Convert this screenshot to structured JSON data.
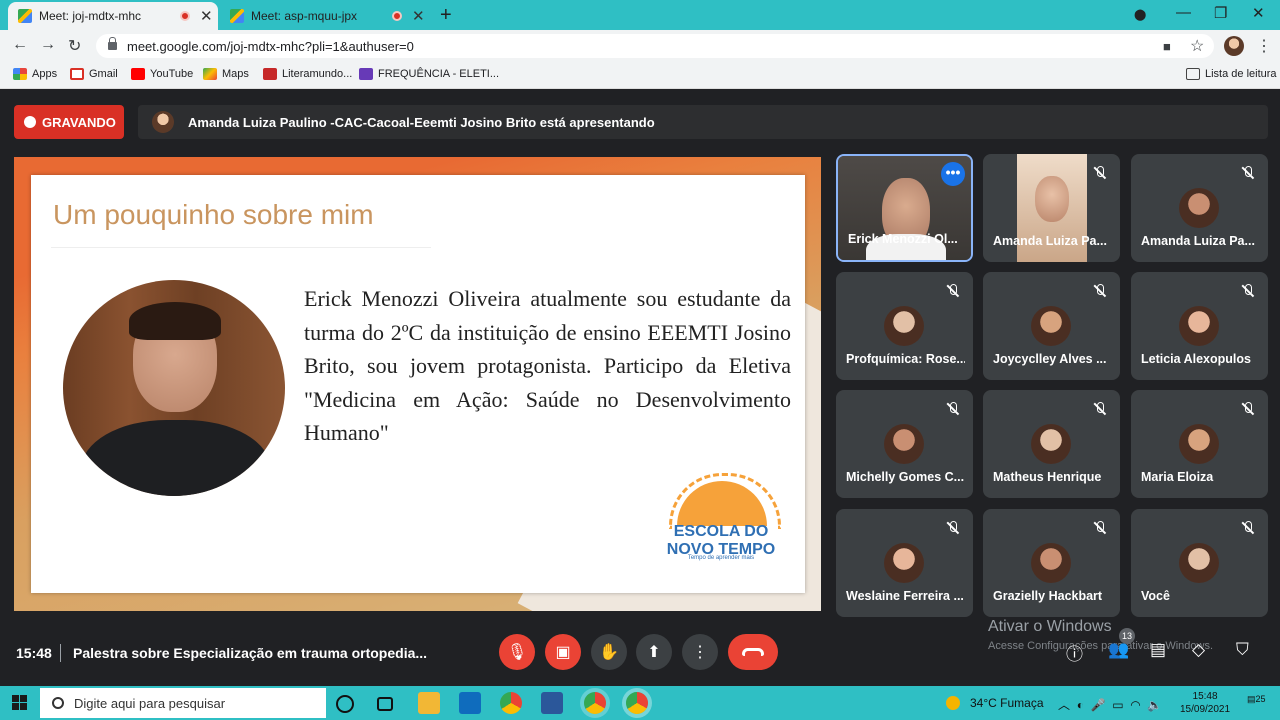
{
  "browser": {
    "tabs": [
      {
        "title": "Meet: joj-mdtx-mhc",
        "active": true
      },
      {
        "title": "Meet: asp-mquu-jpx",
        "active": false
      }
    ],
    "url": "meet.google.com/joj-mdtx-mhc?pli=1&authuser=0",
    "bookmarks": [
      {
        "label": "Apps",
        "color": "#e8453c"
      },
      {
        "label": "Gmail",
        "color": "#d93025"
      },
      {
        "label": "YouTube",
        "color": "#ff0000"
      },
      {
        "label": "Maps",
        "color": "#34a853"
      },
      {
        "label": "Literamundo...",
        "color": "#c62828"
      },
      {
        "label": "FREQUÊNCIA - ELETI...",
        "color": "#673ab7"
      }
    ],
    "reading_list": "Lista de leitura"
  },
  "meet": {
    "recording_label": "GRAVANDO",
    "presenter_banner": "Amanda Luiza Paulino -CAC-Cacoal-Eeemti Josino Brito está apresentando",
    "slide": {
      "title": "Um pouquinho sobre mim",
      "body": "Erick Menozzi Oliveira atualmente sou estudante da turma do 2ºC da instituição de ensino EEEMTI Josino Brito, sou jovem protagonista. Participo da Eletiva \"Medicina em Ação: Saúde no Desenvolvimento Humano\"",
      "logo_line1": "ESCOLA DO",
      "logo_line2": "NOVO TEMPO",
      "logo_tagline": "Tempo de aprender mais"
    },
    "participants": [
      {
        "name": "Erick Menozzi Ol...",
        "video": true,
        "muted": false,
        "highlighted": true
      },
      {
        "name": "Amanda Luiza Pa...",
        "video": true,
        "muted": true
      },
      {
        "name": "Amanda Luiza Pa...",
        "video": false,
        "muted": true
      },
      {
        "name": "Profquímica: Rose...",
        "video": false,
        "muted": true
      },
      {
        "name": "Joycyclley Alves ...",
        "video": false,
        "muted": true
      },
      {
        "name": "Leticia Alexopulos",
        "video": false,
        "muted": true
      },
      {
        "name": "Michelly Gomes C...",
        "video": false,
        "muted": true
      },
      {
        "name": "Matheus Henrique",
        "video": false,
        "muted": true
      },
      {
        "name": "Maria Eloiza",
        "video": false,
        "muted": true
      },
      {
        "name": "Weslaine Ferreira ...",
        "video": false,
        "muted": true
      },
      {
        "name": "Grazielly Hackbart",
        "video": false,
        "muted": true
      },
      {
        "name": "Você",
        "video": false,
        "muted": true
      }
    ],
    "time": "15:48",
    "meeting_title": "Palestra sobre Especialização em trauma ortopedia...",
    "people_count": "13",
    "watermark_line1": "Ativar o Windows",
    "watermark_line2": "Acesse Configurações para ativar o Windows."
  },
  "taskbar": {
    "search_placeholder": "Digite aqui para pesquisar",
    "weather": "34°C  Fumaça",
    "clock_time": "15:48",
    "clock_date": "15/09/2021",
    "notifications": "25"
  }
}
